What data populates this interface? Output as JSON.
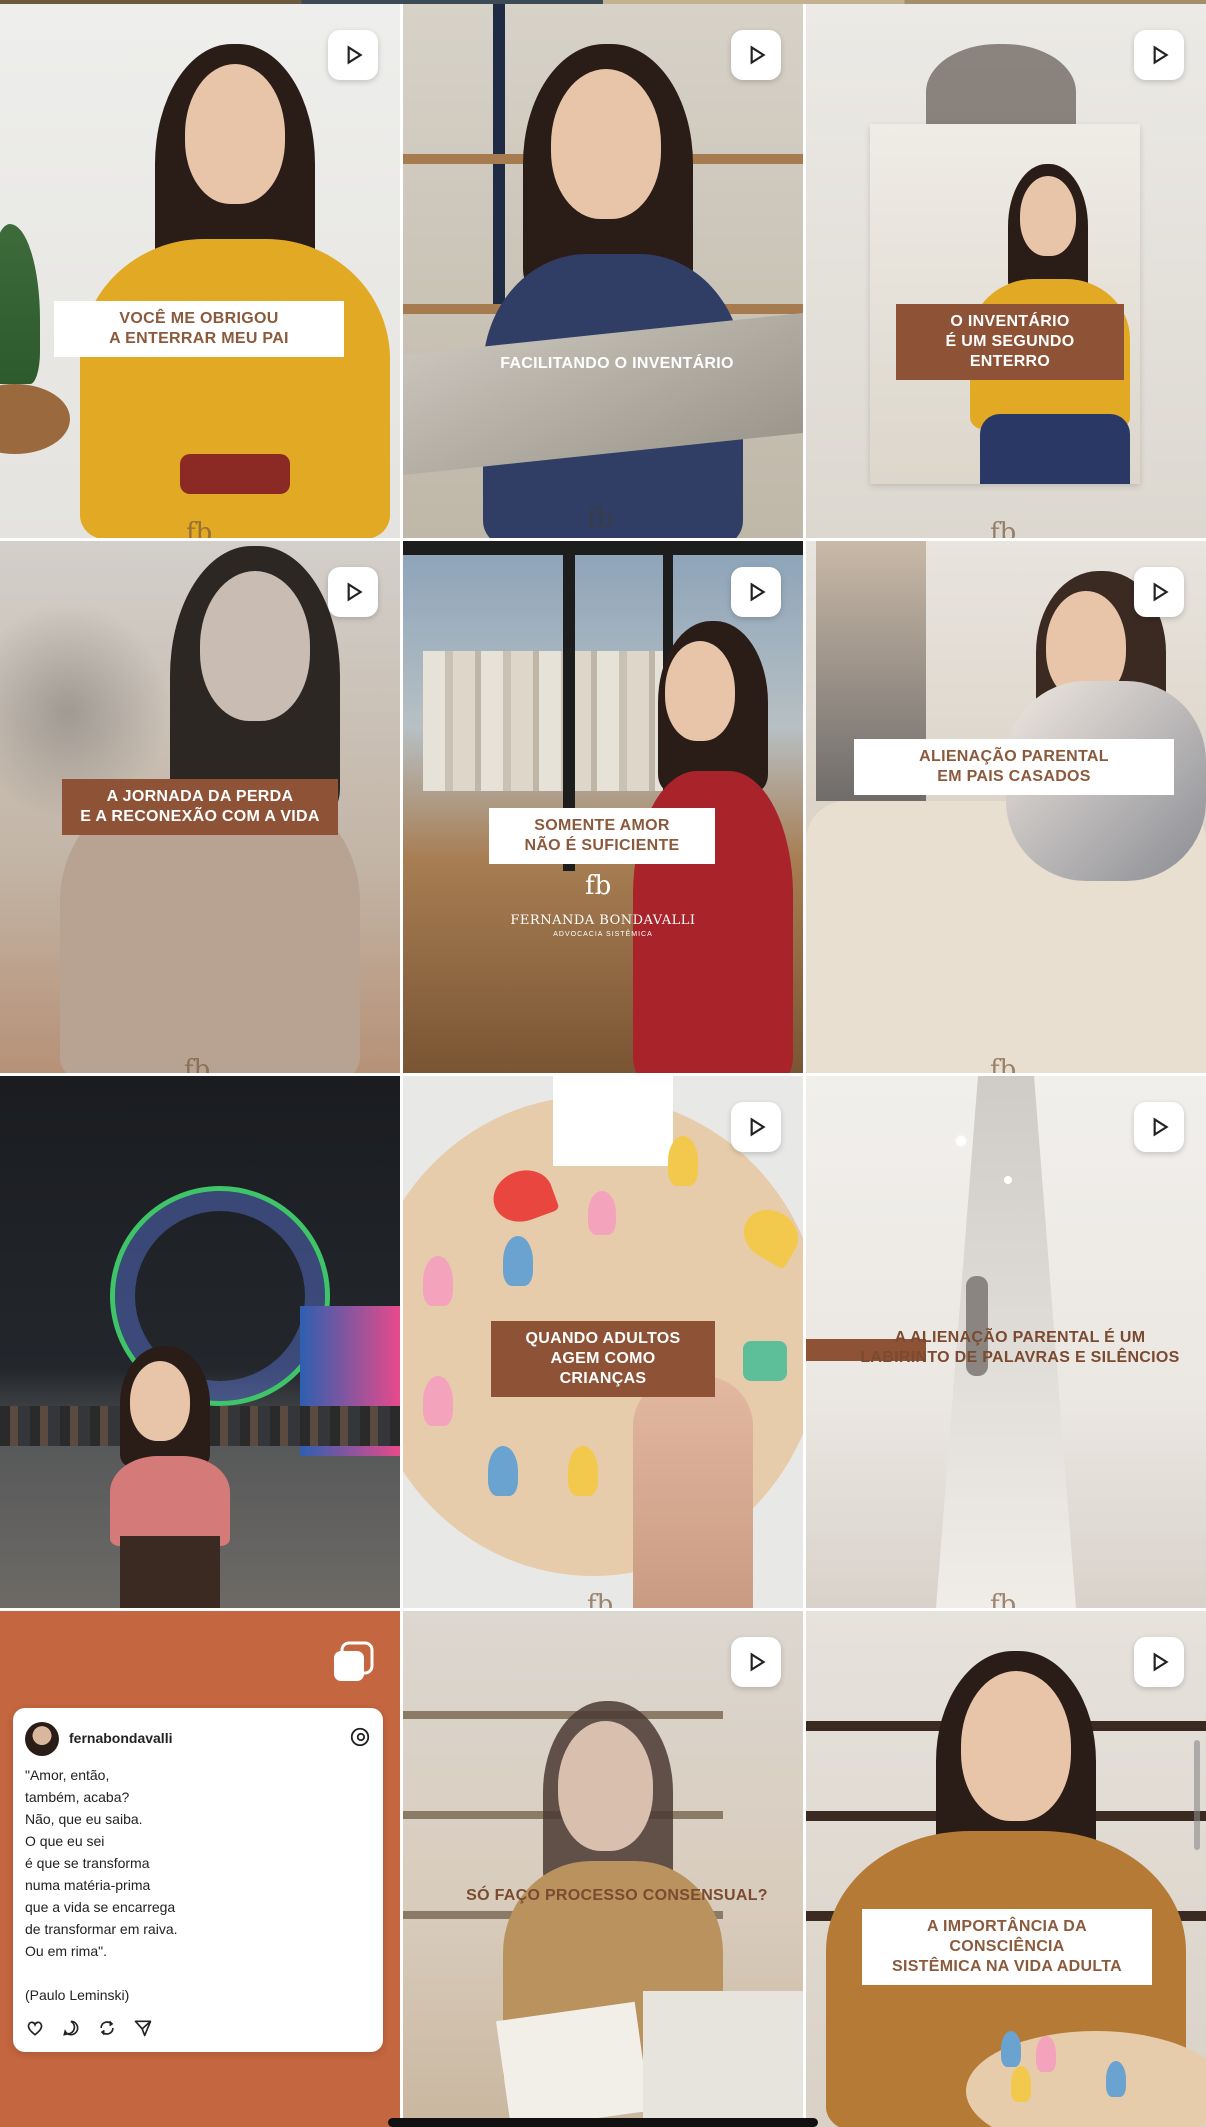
{
  "posts": [
    {
      "type": "reel",
      "caption_lines": [
        "VOCÊ ME OBRIGOU",
        "A ENTERRAR MEU PAI"
      ]
    },
    {
      "type": "reel",
      "caption_lines": [
        "FACILITANDO O INVENTÁRIO"
      ]
    },
    {
      "type": "reel",
      "caption_lines": [
        "O INVENTÁRIO",
        "É UM SEGUNDO ENTERRO"
      ]
    },
    {
      "type": "reel",
      "caption_lines": [
        "A JORNADA DA PERDA",
        "E A RECONEXÃO COM A VIDA"
      ]
    },
    {
      "type": "reel",
      "caption_lines": [
        "SOMENTE AMOR",
        "NÃO É SUFICIENTE"
      ],
      "brand_name": "FERNANDA BONDAVALLI",
      "brand_tagline": "ADVOCACIA SISTÊMICA"
    },
    {
      "type": "reel",
      "caption_lines": [
        "ALIENAÇÃO PARENTAL",
        "EM PAIS CASADOS"
      ]
    },
    {
      "type": "photo",
      "caption_lines": []
    },
    {
      "type": "reel",
      "caption_lines": [
        "QUANDO ADULTOS",
        "AGEM COMO CRIANÇAS"
      ]
    },
    {
      "type": "reel",
      "caption_lines": [
        "A ALIENAÇÃO PARENTAL É UM",
        "LABIRINTO DE PALAVRAS E SILÊNCIOS"
      ]
    },
    {
      "type": "carousel",
      "caption_lines": []
    },
    {
      "type": "reel",
      "caption_lines": [
        "SÓ FAÇO PROCESSO CONSENSUAL?"
      ]
    },
    {
      "type": "reel",
      "caption_lines": [
        "A IMPORTÂNCIA DA CONSCIÊNCIA",
        "SISTÊMICA NA VIDA ADULTA"
      ]
    }
  ],
  "logo_mark": "fb",
  "threads_card": {
    "username": "fernabondavalli",
    "lines": [
      "\"Amor, então,",
      "também, acaba?",
      "Não, que eu saiba.",
      "O que eu sei",
      "é que se transforma",
      "numa matéria-prima",
      "que a vida se encarrega",
      "de transformar em raiva.",
      "Ou em rima\".",
      "",
      "(Paulo Leminski)"
    ]
  },
  "icons": {
    "reel": "play-icon",
    "carousel": "carousel-icon",
    "like": "heart-icon",
    "comment": "comment-icon",
    "repost": "repost-icon",
    "share": "send-icon",
    "threads": "threads-icon"
  },
  "colors": {
    "caption_brown": "#8e5236",
    "caption_text_brown": "#8b5a3c",
    "carousel_bg": "#c4663f",
    "mustard": "#e0a41f"
  }
}
